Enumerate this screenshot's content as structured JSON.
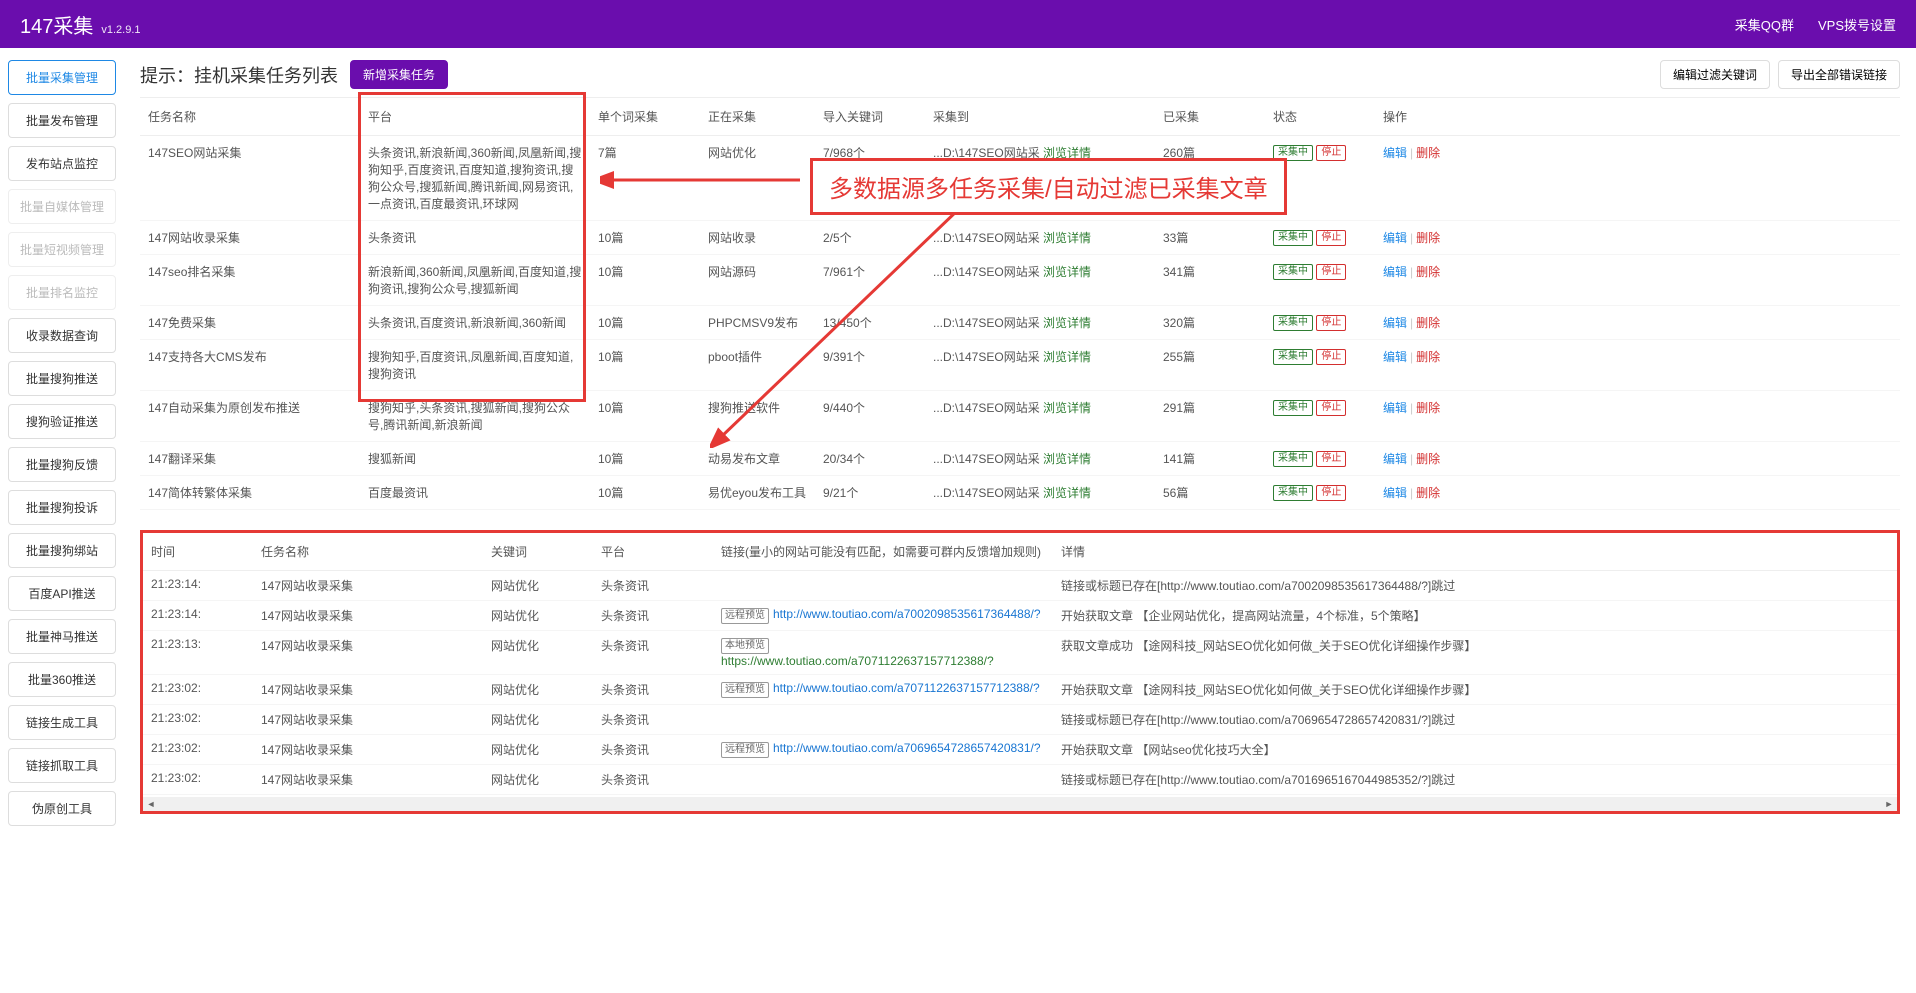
{
  "header": {
    "title": "147采集",
    "version": "v1.2.9.1",
    "links": [
      "采集QQ群",
      "VPS拨号设置"
    ]
  },
  "sidebar": {
    "items": [
      {
        "label": "批量采集管理",
        "state": "active"
      },
      {
        "label": "批量发布管理",
        "state": ""
      },
      {
        "label": "发布站点监控",
        "state": ""
      },
      {
        "label": "批量自媒体管理",
        "state": "disabled"
      },
      {
        "label": "批量短视频管理",
        "state": "disabled"
      },
      {
        "label": "批量排名监控",
        "state": "disabled"
      },
      {
        "label": "收录数据查询",
        "state": ""
      },
      {
        "label": "批量搜狗推送",
        "state": ""
      },
      {
        "label": "搜狗验证推送",
        "state": ""
      },
      {
        "label": "批量搜狗反馈",
        "state": ""
      },
      {
        "label": "批量搜狗投诉",
        "state": ""
      },
      {
        "label": "批量搜狗绑站",
        "state": ""
      },
      {
        "label": "百度API推送",
        "state": ""
      },
      {
        "label": "批量神马推送",
        "state": ""
      },
      {
        "label": "批量360推送",
        "state": ""
      },
      {
        "label": "链接生成工具",
        "state": ""
      },
      {
        "label": "链接抓取工具",
        "state": ""
      },
      {
        "label": "伪原创工具",
        "state": ""
      }
    ]
  },
  "toolbar": {
    "title": "提示：挂机采集任务列表",
    "add_btn": "新增采集任务",
    "filter_btn": "编辑过滤关键词",
    "export_btn": "导出全部错误链接"
  },
  "annotation": "多数据源多任务采集/自动过滤已采集文章",
  "task_table": {
    "headers": [
      "任务名称",
      "平台",
      "单个词采集",
      "正在采集",
      "导入关键词",
      "采集到",
      "已采集",
      "状态",
      "操作"
    ],
    "rows": [
      {
        "name": "147SEO网站采集",
        "platform": "头条资讯,新浪新闻,360新闻,凤凰新闻,搜狗知乎,百度资讯,百度知道,搜狗资讯,搜狗公众号,搜狐新闻,腾讯新闻,网易资讯,一点资讯,百度最资讯,环球网",
        "single": "7篇",
        "collecting": "网站优化",
        "imported": "7/968个",
        "collect_to": "...D:\\147SEO网站采",
        "detail": "浏览详情",
        "collected": "260篇",
        "status": "采集中",
        "stop": "停止",
        "edit": "编辑",
        "del": "删除"
      },
      {
        "name": "147网站收录采集",
        "platform": "头条资讯",
        "single": "10篇",
        "collecting": "网站收录",
        "imported": "2/5个",
        "collect_to": "...D:\\147SEO网站采",
        "detail": "浏览详情",
        "collected": "33篇",
        "status": "采集中",
        "stop": "停止",
        "edit": "编辑",
        "del": "删除"
      },
      {
        "name": "147seo排名采集",
        "platform": "新浪新闻,360新闻,凤凰新闻,百度知道,搜狗资讯,搜狗公众号,搜狐新闻",
        "single": "10篇",
        "collecting": "网站源码",
        "imported": "7/961个",
        "collect_to": "...D:\\147SEO网站采",
        "detail": "浏览详情",
        "collected": "341篇",
        "status": "采集中",
        "stop": "停止",
        "edit": "编辑",
        "del": "删除"
      },
      {
        "name": "147免费采集",
        "platform": "头条资讯,百度资讯,新浪新闻,360新闻",
        "single": "10篇",
        "collecting": "PHPCMSV9发布",
        "imported": "13/450个",
        "collect_to": "...D:\\147SEO网站采",
        "detail": "浏览详情",
        "collected": "320篇",
        "status": "采集中",
        "stop": "停止",
        "edit": "编辑",
        "del": "删除"
      },
      {
        "name": "147支持各大CMS发布",
        "platform": "搜狗知乎,百度资讯,凤凰新闻,百度知道,搜狗资讯",
        "single": "10篇",
        "collecting": "pboot插件",
        "imported": "9/391个",
        "collect_to": "...D:\\147SEO网站采",
        "detail": "浏览详情",
        "collected": "255篇",
        "status": "采集中",
        "stop": "停止",
        "edit": "编辑",
        "del": "删除"
      },
      {
        "name": "147自动采集为原创发布推送",
        "platform": "搜狗知乎,头条资讯,搜狐新闻,搜狗公众号,腾讯新闻,新浪新闻",
        "single": "10篇",
        "collecting": "搜狗推送软件",
        "imported": "9/440个",
        "collect_to": "...D:\\147SEO网站采",
        "detail": "浏览详情",
        "collected": "291篇",
        "status": "采集中",
        "stop": "停止",
        "edit": "编辑",
        "del": "删除"
      },
      {
        "name": "147翻译采集",
        "platform": "搜狐新闻",
        "single": "10篇",
        "collecting": "动易发布文章",
        "imported": "20/34个",
        "collect_to": "...D:\\147SEO网站采",
        "detail": "浏览详情",
        "collected": "141篇",
        "status": "采集中",
        "stop": "停止",
        "edit": "编辑",
        "del": "删除"
      },
      {
        "name": "147简体转繁体采集",
        "platform": "百度最资讯",
        "single": "10篇",
        "collecting": "易优eyou发布工具",
        "imported": "9/21个",
        "collect_to": "...D:\\147SEO网站采",
        "detail": "浏览详情",
        "collected": "56篇",
        "status": "采集中",
        "stop": "停止",
        "edit": "编辑",
        "del": "删除"
      }
    ]
  },
  "log_table": {
    "headers": [
      "时间",
      "任务名称",
      "关键词",
      "平台",
      "链接(量小的网站可能没有匹配，如需要可群内反馈增加规则)",
      "详情"
    ],
    "rows": [
      {
        "time": "21:23:14:",
        "task": "147网站收录采集",
        "key": "网站优化",
        "plat": "头条资讯",
        "tag": "",
        "url": "",
        "detail": "链接或标题已存在[http://www.toutiao.com/a7002098535617364488/?]跳过"
      },
      {
        "time": "21:23:14:",
        "task": "147网站收录采集",
        "key": "网站优化",
        "plat": "头条资讯",
        "tag": "远程预览",
        "url": "http://www.toutiao.com/a7002098535617364488/?",
        "detail": "开始获取文章 【企业网站优化，提高网站流量，4个标准，5个策略】"
      },
      {
        "time": "21:23:13:",
        "task": "147网站收录采集",
        "key": "网站优化",
        "plat": "头条资讯",
        "tag": "本地预览",
        "url": "https://www.toutiao.com/a7071122637157712388/?",
        "url_green": true,
        "detail": "获取文章成功 【途网科技_网站SEO优化如何做_关于SEO优化详细操作步骤】"
      },
      {
        "time": "21:23:02:",
        "task": "147网站收录采集",
        "key": "网站优化",
        "plat": "头条资讯",
        "tag": "远程预览",
        "url": "http://www.toutiao.com/a7071122637157712388/?",
        "detail": "开始获取文章 【途网科技_网站SEO优化如何做_关于SEO优化详细操作步骤】"
      },
      {
        "time": "21:23:02:",
        "task": "147网站收录采集",
        "key": "网站优化",
        "plat": "头条资讯",
        "tag": "",
        "url": "",
        "detail": "链接或标题已存在[http://www.toutiao.com/a7069654728657420831/?]跳过"
      },
      {
        "time": "21:23:02:",
        "task": "147网站收录采集",
        "key": "网站优化",
        "plat": "头条资讯",
        "tag": "远程预览",
        "url": "http://www.toutiao.com/a7069654728657420831/?",
        "detail": "开始获取文章 【网站seo优化技巧大全】"
      },
      {
        "time": "21:23:02:",
        "task": "147网站收录采集",
        "key": "网站优化",
        "plat": "头条资讯",
        "tag": "",
        "url": "",
        "detail": "链接或标题已存在[http://www.toutiao.com/a7016965167044985352/?]跳过"
      }
    ]
  }
}
